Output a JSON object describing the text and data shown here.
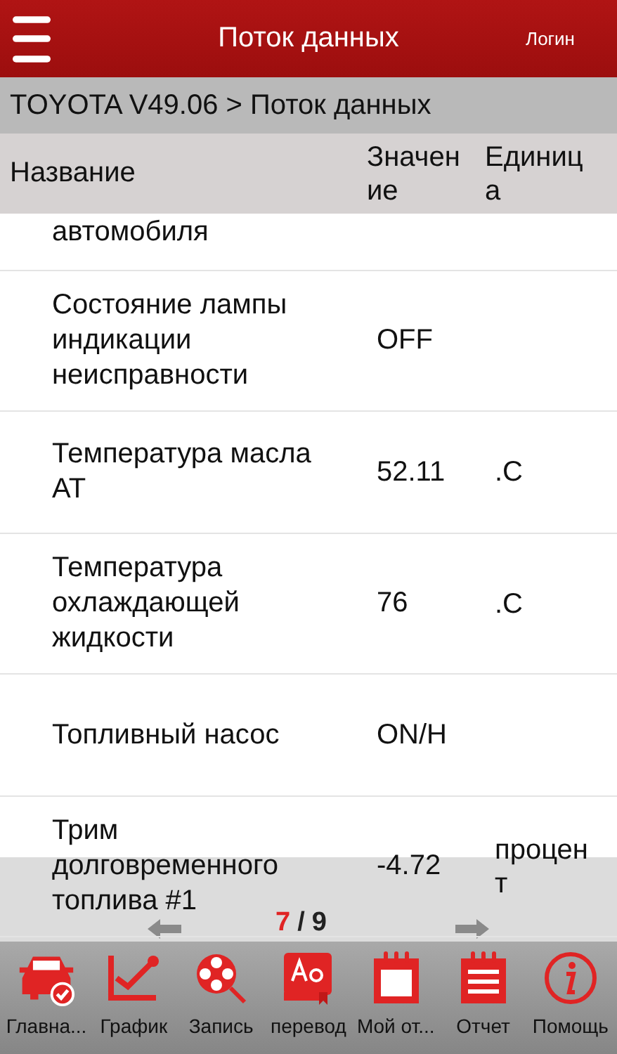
{
  "header": {
    "title": "Поток данных",
    "login": "Логин"
  },
  "breadcrumb": "TOYOTA V49.06 > Поток данных",
  "columns": [
    "Название",
    "Значение",
    "Единица"
  ],
  "rows": [
    {
      "name": "автомобиля",
      "value": "",
      "unit": ""
    },
    {
      "name": "Состояние лампы индикации неисправности",
      "value": "OFF",
      "unit": ""
    },
    {
      "name": "Температура масла AT",
      "value": "52.11",
      "unit": ".C"
    },
    {
      "name": "Температура охлаждающей жидкости",
      "value": "76",
      "unit": ".C"
    },
    {
      "name": "Топливный насос",
      "value": "ON/H",
      "unit": ""
    },
    {
      "name": "Трим долговременного топлива  #1",
      "value": "-4.72",
      "unit": "процент"
    }
  ],
  "pager": {
    "current": "7",
    "separator": "/",
    "total": "9"
  },
  "toolbar": [
    {
      "kind": "car",
      "label": "Главна..."
    },
    {
      "kind": "chart",
      "label": "График"
    },
    {
      "kind": "reel",
      "label": "Запись"
    },
    {
      "kind": "dictionary",
      "label": "перевод"
    },
    {
      "kind": "calendar",
      "label": "Мой от..."
    },
    {
      "kind": "list",
      "label": "Отчет"
    },
    {
      "kind": "info",
      "label": "Помощь"
    }
  ]
}
